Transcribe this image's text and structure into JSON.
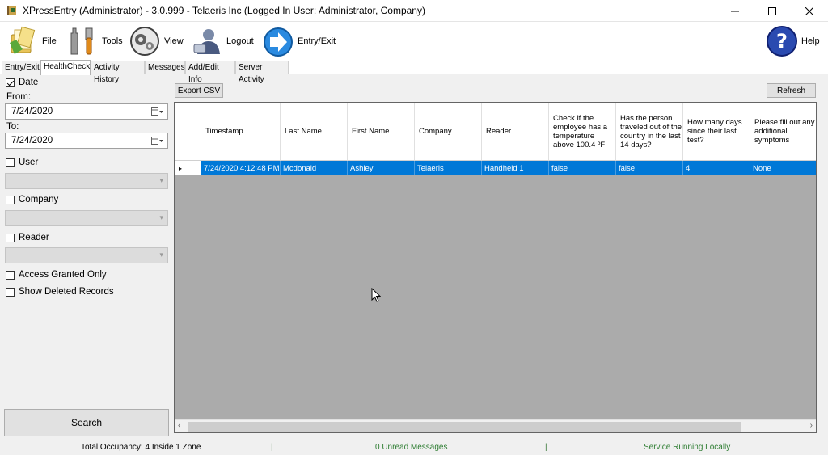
{
  "window": {
    "title": "XPressEntry (Administrator)  - 3.0.999 - Telaeris Inc (Logged In User: Administrator, Company)"
  },
  "toolbar": {
    "file": "File",
    "tools": "Tools",
    "view": "View",
    "logout": "Logout",
    "entry_exit": "Entry/Exit",
    "help": "Help"
  },
  "tabs": [
    "Entry/Exit",
    "HealthCheck",
    "Activity History",
    "Messages",
    "Add/Edit Info",
    "Server Activity"
  ],
  "filters": {
    "date_label": "Date",
    "date_checked": true,
    "from_label": "From:",
    "from_value": "7/24/2020",
    "to_label": "To:",
    "to_value": "7/24/2020",
    "user_label": "User",
    "company_label": "Company",
    "reader_label": "Reader",
    "access_granted_label": "Access Granted Only",
    "show_deleted_label": "Show Deleted Records",
    "search_label": "Search"
  },
  "actions": {
    "export_csv": "Export CSV",
    "refresh": "Refresh"
  },
  "table": {
    "columns": [
      "Timestamp",
      "Last Name",
      "First Name",
      "Company",
      "Reader",
      "Check if the employee has a temperature above 100.4 ºF",
      "Has the person traveled out of the country in the last 14 days?",
      "How many days since their last test?",
      "Please fill out any additional symptoms"
    ],
    "rows": [
      [
        "7/24/2020 4:12:48 PM",
        "Mcdonald",
        "Ashley",
        "Telaeris",
        "Handheld 1",
        "false",
        "false",
        "4",
        "None"
      ]
    ],
    "row_indicator": "▸"
  },
  "status": {
    "occupancy": "Total Occupancy: 4 Inside 1 Zone",
    "messages": "0 Unread Messages",
    "service": "Service Running Locally"
  },
  "colors": {
    "selection": "#0078d7",
    "status_green": "#2e7d32"
  }
}
